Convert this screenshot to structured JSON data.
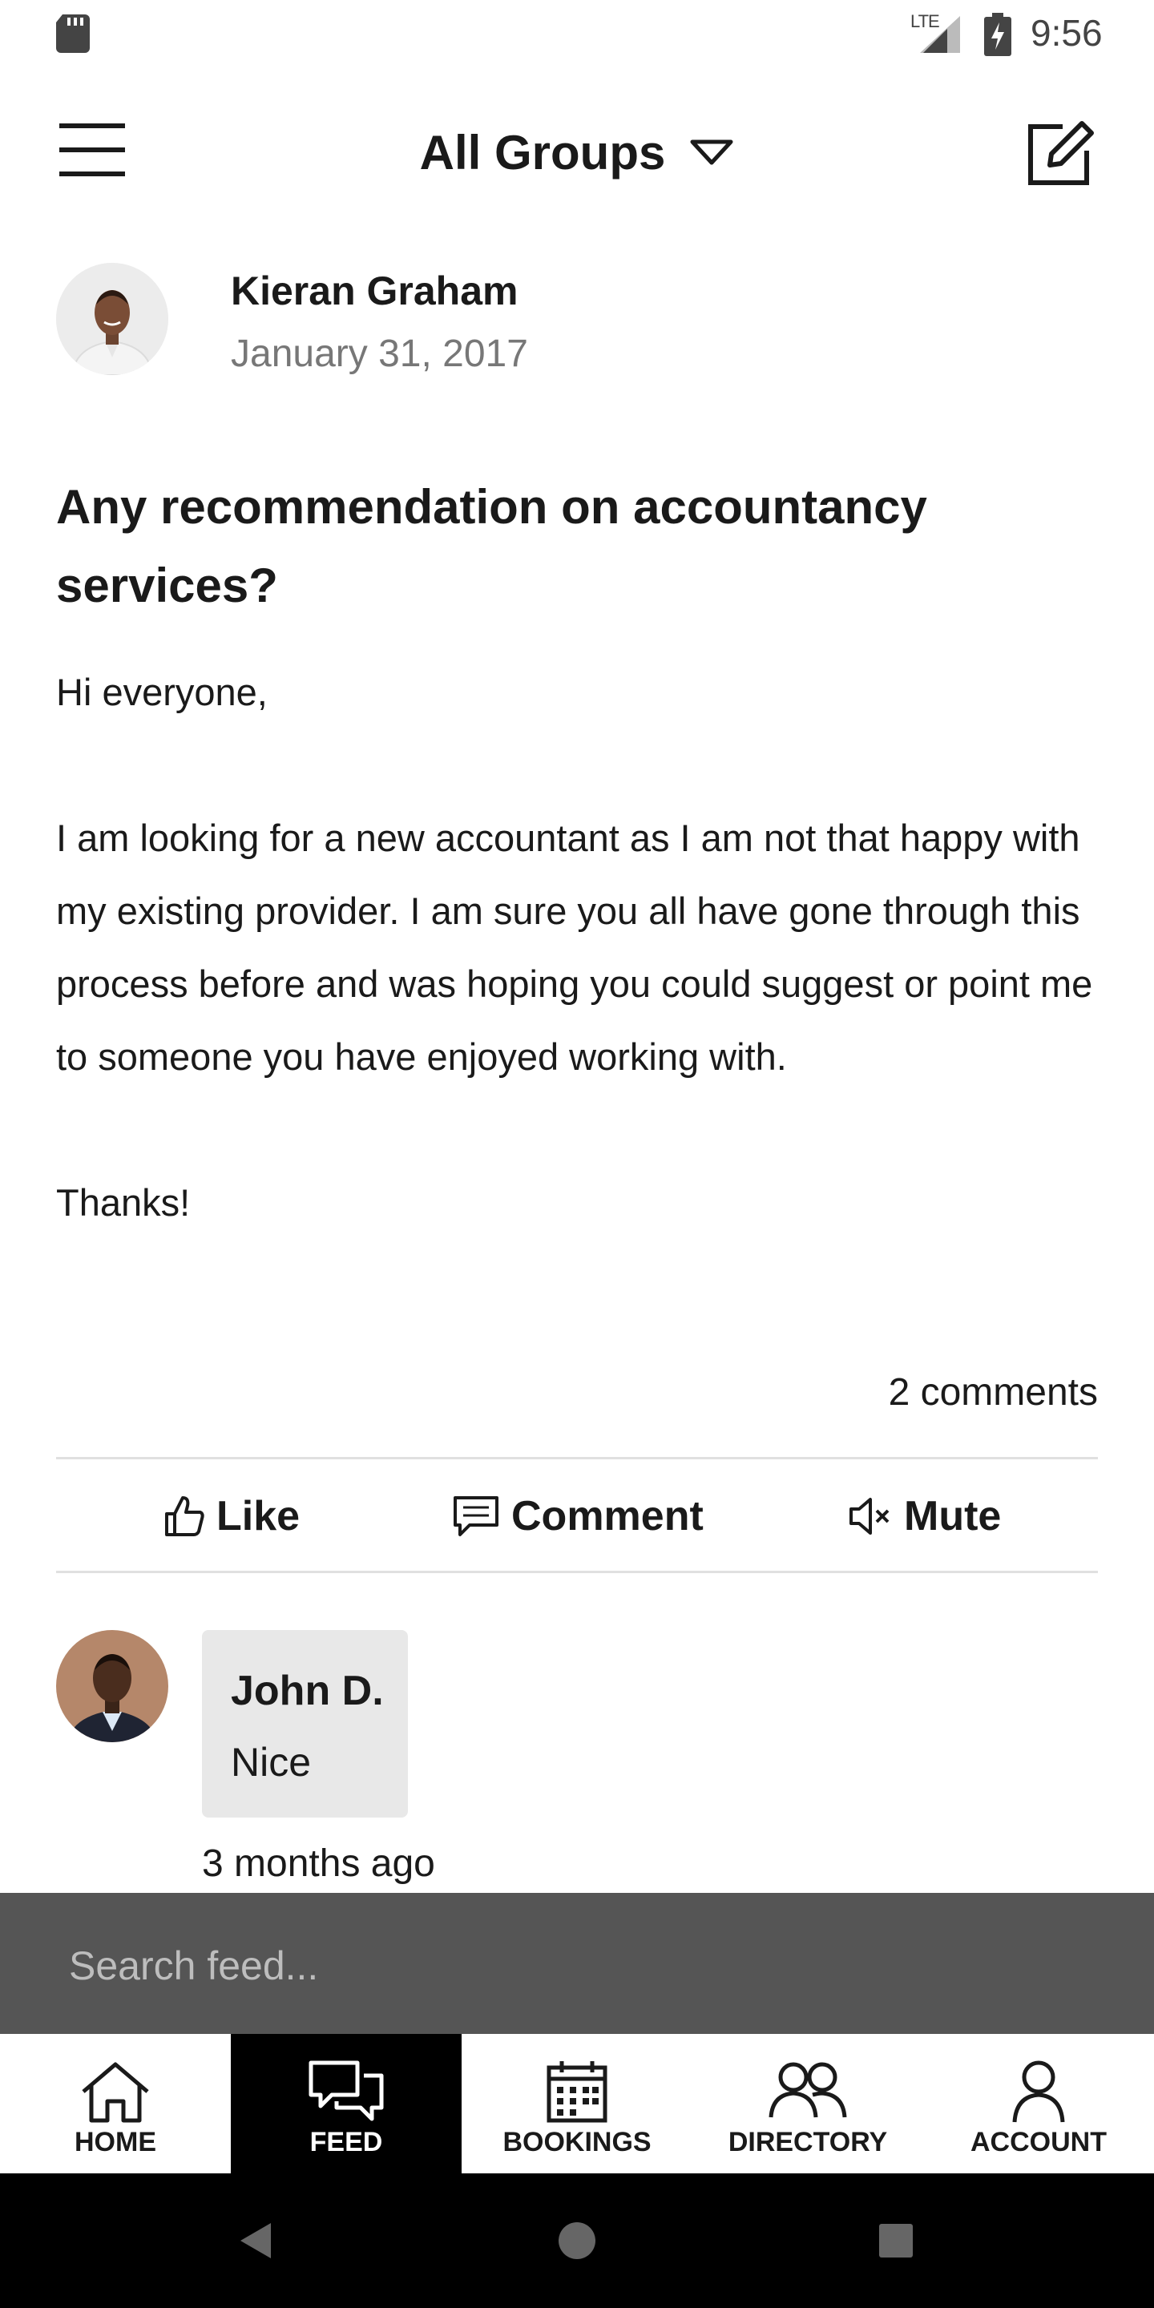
{
  "status_bar": {
    "network": "LTE",
    "time": "9:56"
  },
  "header": {
    "title": "All Groups"
  },
  "post": {
    "author": "Kieran Graham",
    "date": "January 31, 2017",
    "title": "Any recommendation on accountancy services?",
    "body": "Hi everyone,\n\nI am looking for a new accountant as I am not that happy with my existing provider. I am sure you all have gone through this process before and was hoping you could suggest or point me to someone you have enjoyed working with.\n\nThanks!",
    "comments_count": "2 comments"
  },
  "actions": {
    "like": "Like",
    "comment": "Comment",
    "mute": "Mute"
  },
  "comment": {
    "author": "John D.",
    "text": "Nice",
    "time": "3 months ago"
  },
  "search": {
    "placeholder": "Search feed..."
  },
  "nav": {
    "items": [
      {
        "label": "HOME",
        "icon": "home-icon"
      },
      {
        "label": "FEED",
        "icon": "chat-bubbles-icon",
        "active": true
      },
      {
        "label": "BOOKINGS",
        "icon": "calendar-icon"
      },
      {
        "label": "DIRECTORY",
        "icon": "people-icon"
      },
      {
        "label": "ACCOUNT",
        "icon": "person-icon"
      }
    ]
  },
  "colors": {
    "search_bar": "#555555",
    "active_nav": "#000000",
    "divider": "#e0e0e0",
    "bubble": "#e8e8e8"
  }
}
